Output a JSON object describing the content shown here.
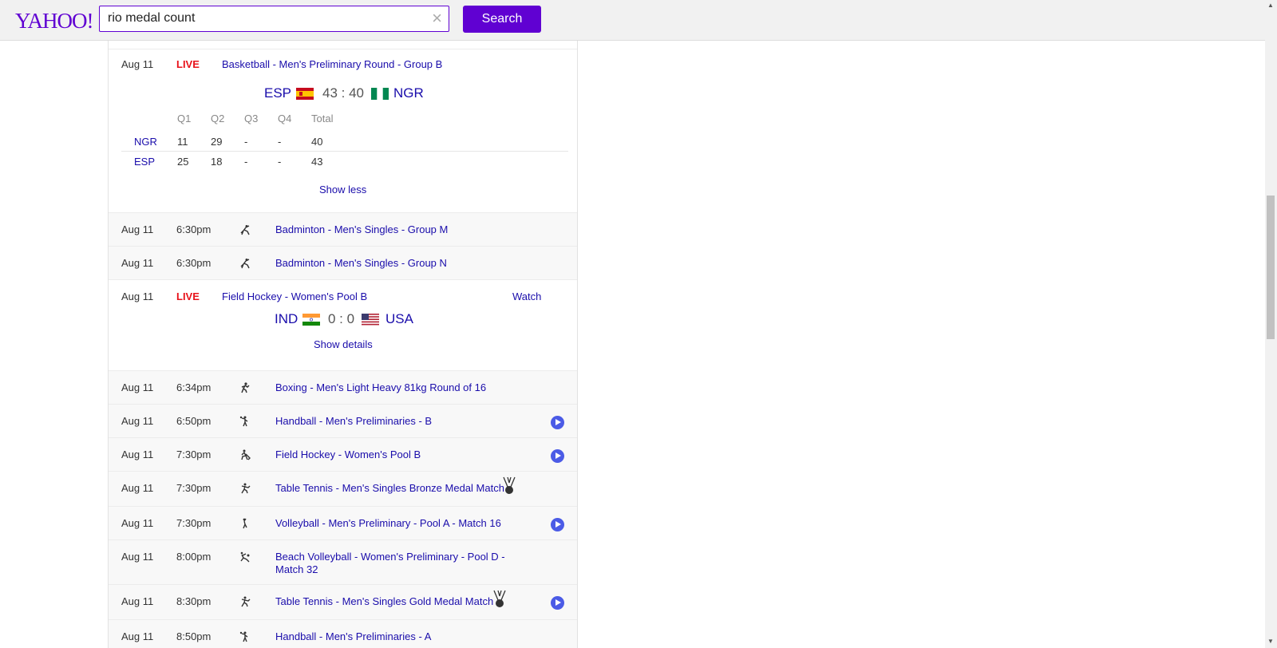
{
  "header": {
    "logo": "YAHOO!",
    "search_value": "rio medal count",
    "search_button": "Search"
  },
  "live_basketball": {
    "date": "Aug 11",
    "status": "LIVE",
    "title": "Basketball - Men's Preliminary Round - Group B",
    "team_left": "ESP",
    "score": "43 : 40",
    "team_right": "NGR",
    "quarter_headers": [
      "Q1",
      "Q2",
      "Q3",
      "Q4",
      "Total"
    ],
    "rows": [
      {
        "team": "NGR",
        "q1": "11",
        "q2": "29",
        "q3": "-",
        "q4": "-",
        "total": "40"
      },
      {
        "team": "ESP",
        "q1": "25",
        "q2": "18",
        "q3": "-",
        "q4": "-",
        "total": "43"
      }
    ],
    "toggle": "Show less"
  },
  "badminton_m": {
    "date": "Aug 11",
    "time": "6:30pm",
    "title": "Badminton - Men's Singles - Group M",
    "icon": "badminton-icon"
  },
  "badminton_n": {
    "date": "Aug 11",
    "time": "6:30pm",
    "title": "Badminton - Men's Singles - Group N",
    "icon": "badminton-icon"
  },
  "live_hockey": {
    "date": "Aug 11",
    "status": "LIVE",
    "title": "Field Hockey - Women's Pool B",
    "watch": "Watch",
    "team_left": "IND",
    "score": "0 : 0",
    "team_right": "USA",
    "toggle": "Show details"
  },
  "events": [
    {
      "date": "Aug 11",
      "time": "6:34pm",
      "title": "Boxing - Men's Light Heavy 81kg Round of 16",
      "icon": "boxing-icon"
    },
    {
      "date": "Aug 11",
      "time": "6:50pm",
      "title": "Handball - Men's Preliminaries - B",
      "icon": "handball-icon"
    },
    {
      "date": "Aug 11",
      "time": "7:30pm",
      "title": "Field Hockey - Women's Pool B",
      "icon": "field-hockey-icon"
    },
    {
      "date": "Aug 11",
      "time": "7:30pm",
      "title": "Table Tennis - Men's Singles Bronze Medal Match",
      "icon": "table-tennis-icon"
    },
    {
      "date": "Aug 11",
      "time": "7:30pm",
      "title": "Volleyball - Men's Preliminary - Pool A - Match 16",
      "icon": "volleyball-icon"
    },
    {
      "date": "Aug 11",
      "time": "8:00pm",
      "title": "Beach Volleyball - Women's Preliminary - Pool D -",
      "title2": "Match 32",
      "icon": "beach-volleyball-icon"
    },
    {
      "date": "Aug 11",
      "time": "8:30pm",
      "title": "Table Tennis - Men's Singles Gold Medal Match",
      "icon": "table-tennis-icon"
    },
    {
      "date": "Aug 11",
      "time": "8:50pm",
      "title": "Handball - Men's Preliminaries - A",
      "icon": "handball-icon"
    }
  ],
  "colors": {
    "brand": "#6001d2",
    "live": "#e8131b",
    "link": "#1a0dab",
    "play": "#4b5be6"
  }
}
